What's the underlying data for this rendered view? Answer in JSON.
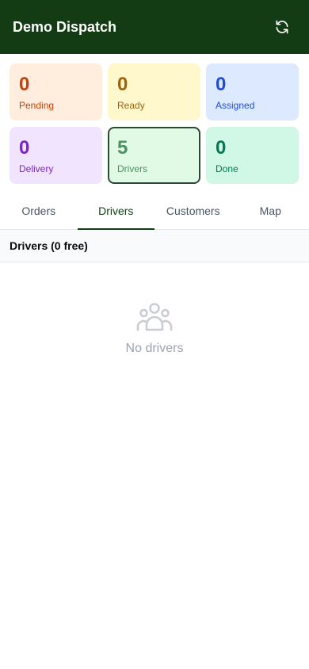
{
  "header": {
    "title": "Demo Dispatch",
    "refresh_icon": "refresh-icon"
  },
  "stats": [
    {
      "key": "pending",
      "count": "0",
      "label": "Pending",
      "bg": "#ffeedd",
      "num_color": "#c2410c",
      "label_color": "#c2410c",
      "selected": false
    },
    {
      "key": "ready",
      "count": "0",
      "label": "Ready",
      "bg": "#fff8cc",
      "num_color": "#a16207",
      "label_color": "#a16207",
      "selected": false
    },
    {
      "key": "assigned",
      "count": "0",
      "label": "Assigned",
      "bg": "#dde9ff",
      "num_color": "#1d4ed8",
      "label_color": "#1d4ed8",
      "selected": false
    },
    {
      "key": "delivery",
      "count": "0",
      "label": "Delivery",
      "bg": "#f1e4ff",
      "num_color": "#7e22ce",
      "label_color": "#7e22ce",
      "selected": false
    },
    {
      "key": "drivers",
      "count": "5",
      "label": "Drivers",
      "bg": "#e1fae6",
      "num_color": "#4a9160",
      "label_color": "#4a9160",
      "selected": true
    },
    {
      "key": "done",
      "count": "0",
      "label": "Done",
      "bg": "#d1f7e6",
      "num_color": "#047857",
      "label_color": "#047857",
      "selected": false
    }
  ],
  "tabs": [
    {
      "label": "Orders",
      "active": false
    },
    {
      "label": "Drivers",
      "active": true
    },
    {
      "label": "Customers",
      "active": false
    },
    {
      "label": "Map",
      "active": false
    }
  ],
  "section": {
    "title": "Drivers (0 free)"
  },
  "empty_state": {
    "icon": "users-icon",
    "text": "No drivers"
  },
  "colors": {
    "header_bg": "#133c14",
    "accent": "#133c14"
  }
}
